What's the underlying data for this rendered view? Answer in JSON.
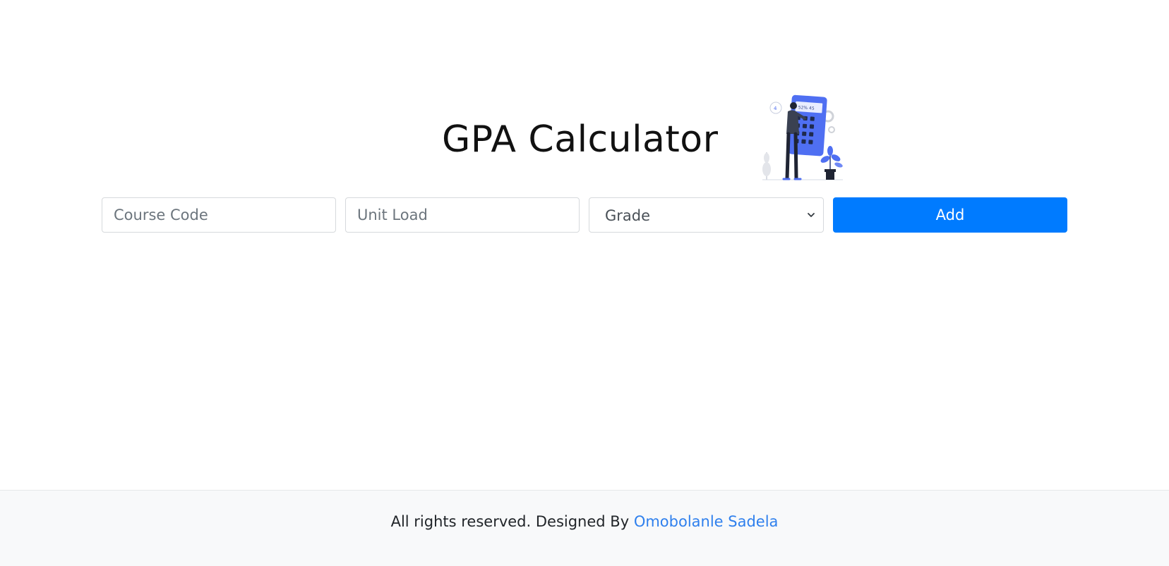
{
  "header": {
    "title": "GPA Calculator",
    "illustration_screen_text": "52% 45"
  },
  "form": {
    "course_code_placeholder": "Course Code",
    "unit_load_placeholder": "Unit Load",
    "grade_selected": "Grade",
    "add_label": "Add"
  },
  "footer": {
    "text": "All rights reserved. Designed By ",
    "author_link": "Omobolanle Sadela"
  },
  "colors": {
    "primary": "#007bff",
    "link": "#2f80ed",
    "illustration_accent": "#4f6ff2",
    "footer_bg": "#f8f9fa"
  }
}
